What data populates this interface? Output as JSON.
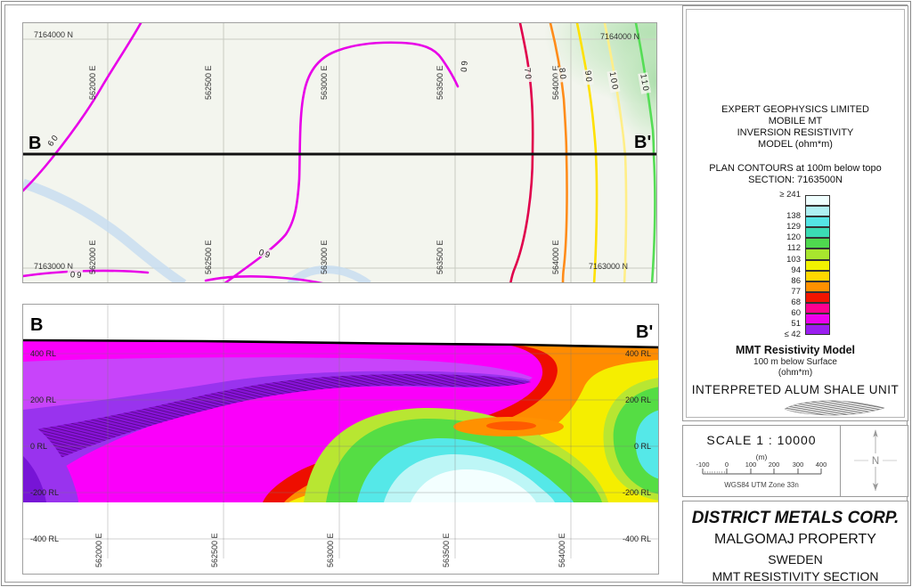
{
  "plan": {
    "label_b": "B",
    "label_b_prime": "B'",
    "north_labels": {
      "top_left": "7164000 N",
      "top_right": "7164000 N",
      "bottom_left": "7163000 N",
      "bottom_right": "7163000 N"
    },
    "easting_labels": [
      "562000 E",
      "562500 E",
      "563000 E",
      "563500 E",
      "564000 E"
    ],
    "contours": {
      "c60": "60",
      "c70": "70",
      "c80": "80",
      "c90": "90",
      "c100": "100",
      "c110": "110"
    },
    "contour_colors": {
      "c60": "#e800e8",
      "c70": "#e0004c",
      "c80": "#ff8c1a",
      "c90": "#ffe100",
      "c100": "#ffee88",
      "c110": "#55dd55"
    }
  },
  "section": {
    "label_b": "B",
    "label_b_prime": "B'",
    "rl_labels": [
      "400 RL",
      "200 RL",
      "0 RL",
      "-200 RL",
      "-400 RL"
    ],
    "easting_labels": [
      "562000 E",
      "562500 E",
      "563000 E",
      "563500 E",
      "564000 E"
    ],
    "palette": {
      "magenta": "#fa00fa",
      "red": "#ee0e00",
      "orange": "#ff8c00",
      "yellow": "#f5ee00",
      "yellow_green": "#b8e632",
      "green": "#55dd44",
      "cyan": "#55e8e8",
      "pale_cyan": "#bdf6f6",
      "white_core": "#f3ffff",
      "violet": "#c844fa",
      "purple": "#9933ee",
      "dark_purple": "#7714d6",
      "shale_core": "#8812d8",
      "orange_lens": "#ff9100",
      "red_lens": "#ff5a00"
    }
  },
  "legend": {
    "title_lines": [
      "EXPERT GEOPHYSICS LIMITED",
      "MOBILE MT",
      "INVERSION RESISTIVITY",
      "MODEL (ohm*m)"
    ],
    "subtitle_lines": [
      "PLAN CONTOURS at 100m below topo",
      "SECTION: 7163500N"
    ],
    "colorbar": {
      "rows": [
        {
          "label": "≥ 241",
          "color": "#effefe"
        },
        {
          "label": "",
          "color": "#aeeff2"
        },
        {
          "label": "138",
          "color": "#55e5e5"
        },
        {
          "label": "129",
          "color": "#3bdcb4"
        },
        {
          "label": "120",
          "color": "#4fd94f"
        },
        {
          "label": "112",
          "color": "#a8e62e"
        },
        {
          "label": "103",
          "color": "#f2f200"
        },
        {
          "label": "94",
          "color": "#ffd800"
        },
        {
          "label": "86",
          "color": "#ff9100"
        },
        {
          "label": "77",
          "color": "#f21500"
        },
        {
          "label": "68",
          "color": "#ff0090"
        },
        {
          "label": "60",
          "color": "#ee00ee"
        },
        {
          "label": "51",
          "color": "#9b1ff0"
        }
      ],
      "bottom_label": "≤ 42"
    },
    "model_title": "MMT Resistivity Model",
    "model_sub1": "100 m below Surface",
    "model_sub2": "(ohm*m)",
    "alum_title": "INTERPRETED ALUM SHALE UNIT"
  },
  "scalebar": {
    "title": "SCALE  1 : 10000",
    "unit": "(m)",
    "ticks": [
      "-100",
      "0",
      "100",
      "200",
      "300",
      "400"
    ],
    "datum": "WGS84 UTM Zone 33n",
    "north": "N"
  },
  "titleblock": {
    "company": "DISTRICT METALS CORP.",
    "property": "MALGOMAJ PROPERTY",
    "country": "SWEDEN",
    "subtitle": "MMT RESISTIVITY SECTION"
  }
}
